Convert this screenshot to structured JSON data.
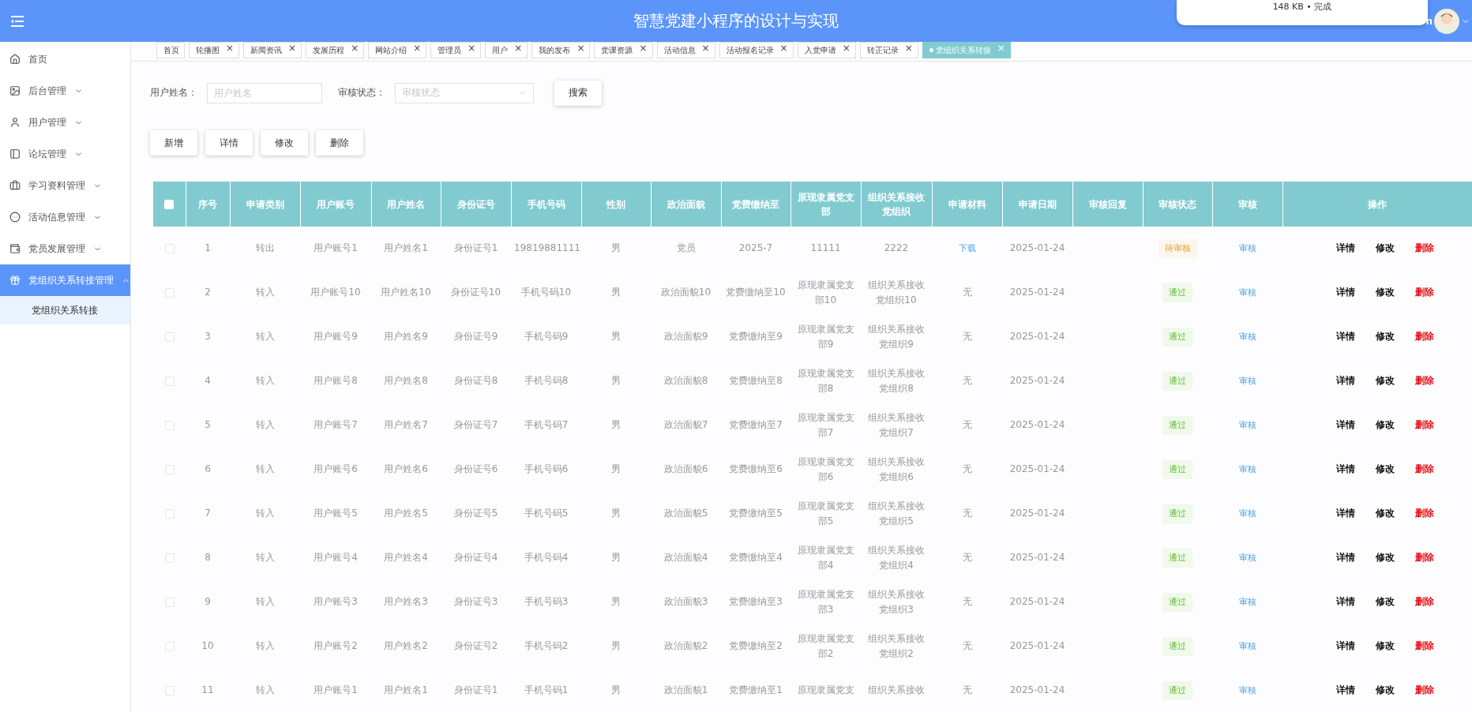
{
  "header": {
    "title": "智慧党建小程序的设计与实现",
    "user_fragment": "n"
  },
  "download_popup": {
    "text": "148 KB • 完成"
  },
  "sidebar": {
    "items": [
      {
        "label": "首页",
        "selected": false
      },
      {
        "label": "后台管理",
        "selected": false,
        "expanded": false
      },
      {
        "label": "用户管理",
        "selected": false,
        "expanded": false
      },
      {
        "label": "论坛管理",
        "selected": false,
        "expanded": false
      },
      {
        "label": "学习资料管理",
        "selected": false,
        "expanded": false
      },
      {
        "label": "活动信息管理",
        "selected": false,
        "expanded": false
      },
      {
        "label": "党员发展管理",
        "selected": false,
        "expanded": false
      },
      {
        "label": "党组织关系转接管理",
        "selected": true,
        "expanded": true,
        "children": [
          {
            "label": "党组织关系转接",
            "selected": true
          }
        ]
      }
    ]
  },
  "tabs": [
    {
      "label": "首页",
      "selected": false,
      "closable": false
    },
    {
      "label": "轮播图",
      "selected": false,
      "closable": true
    },
    {
      "label": "新闻资讯",
      "selected": false,
      "closable": true
    },
    {
      "label": "发展历程",
      "selected": false,
      "closable": true
    },
    {
      "label": "网站介绍",
      "selected": false,
      "closable": true
    },
    {
      "label": "管理员",
      "selected": false,
      "closable": true
    },
    {
      "label": "用户",
      "selected": false,
      "closable": true
    },
    {
      "label": "我的发布",
      "selected": false,
      "closable": true
    },
    {
      "label": "党课资源",
      "selected": false,
      "closable": true
    },
    {
      "label": "活动信息",
      "selected": false,
      "closable": true
    },
    {
      "label": "活动报名记录",
      "selected": false,
      "closable": true
    },
    {
      "label": "入党申请",
      "selected": false,
      "closable": true
    },
    {
      "label": "转正记录",
      "selected": false,
      "closable": true
    },
    {
      "label": "党组织关系转接",
      "selected": true,
      "closable": true
    }
  ],
  "tab_close_glyph": "×",
  "filters": [
    {
      "label": "用户姓名：",
      "kind": "input",
      "placeholder": "用户姓名"
    },
    {
      "label": "审核状态：",
      "kind": "select",
      "placeholder": "审核状态"
    }
  ],
  "search_button": "搜索",
  "actions": [
    "新增",
    "详情",
    "修改",
    "删除"
  ],
  "table": {
    "select_all_checked": false,
    "columns": [
      "序号",
      "申请类别",
      "用户账号",
      "用户姓名",
      "身份证号",
      "手机号码",
      "性别",
      "政治面貌",
      "党费缴纳至",
      "原现隶属党支部",
      "组织关系接收党组织",
      "申请材料",
      "申请日期",
      "审核回复",
      "审核状态",
      "审核",
      "操作"
    ],
    "rows": [
      {
        "checked": false,
        "cells": [
          "1",
          "转出",
          "用户账号1",
          "用户姓名1",
          "身份证号1",
          "19819881111",
          "男",
          "党员",
          "2025-7",
          "11111",
          "2222"
        ],
        "material": {
          "kind": "link",
          "text": "下载"
        },
        "date": "2025-01-24",
        "reply": "",
        "status": {
          "kind": "pending",
          "text": "待审核"
        },
        "review": "审核",
        "ops": [
          "详情",
          "修改",
          "删除"
        ]
      },
      {
        "checked": false,
        "cells": [
          "2",
          "转入",
          "用户账号10",
          "用户姓名10",
          "身份证号10",
          "手机号码10",
          "男",
          "政治面貌10",
          "党费缴纳至10",
          "原现隶属党支部10",
          "组织关系接收党组织10"
        ],
        "material": {
          "kind": "text",
          "text": "无"
        },
        "date": "2025-01-24",
        "reply": "",
        "status": {
          "kind": "approved",
          "text": "通过"
        },
        "review": "审核",
        "ops": [
          "详情",
          "修改",
          "删除"
        ]
      },
      {
        "checked": false,
        "cells": [
          "3",
          "转入",
          "用户账号9",
          "用户姓名9",
          "身份证号9",
          "手机号码9",
          "男",
          "政治面貌9",
          "党费缴纳至9",
          "原现隶属党支部9",
          "组织关系接收党组织9"
        ],
        "material": {
          "kind": "text",
          "text": "无"
        },
        "date": "2025-01-24",
        "reply": "",
        "status": {
          "kind": "approved",
          "text": "通过"
        },
        "review": "审核",
        "ops": [
          "详情",
          "修改",
          "删除"
        ]
      },
      {
        "checked": false,
        "cells": [
          "4",
          "转入",
          "用户账号8",
          "用户姓名8",
          "身份证号8",
          "手机号码8",
          "男",
          "政治面貌8",
          "党费缴纳至8",
          "原现隶属党支部8",
          "组织关系接收党组织8"
        ],
        "material": {
          "kind": "text",
          "text": "无"
        },
        "date": "2025-01-24",
        "reply": "",
        "status": {
          "kind": "approved",
          "text": "通过"
        },
        "review": "审核",
        "ops": [
          "详情",
          "修改",
          "删除"
        ]
      },
      {
        "checked": false,
        "cells": [
          "5",
          "转入",
          "用户账号7",
          "用户姓名7",
          "身份证号7",
          "手机号码7",
          "男",
          "政治面貌7",
          "党费缴纳至7",
          "原现隶属党支部7",
          "组织关系接收党组织7"
        ],
        "material": {
          "kind": "text",
          "text": "无"
        },
        "date": "2025-01-24",
        "reply": "",
        "status": {
          "kind": "approved",
          "text": "通过"
        },
        "review": "审核",
        "ops": [
          "详情",
          "修改",
          "删除"
        ]
      },
      {
        "checked": false,
        "cells": [
          "6",
          "转入",
          "用户账号6",
          "用户姓名6",
          "身份证号6",
          "手机号码6",
          "男",
          "政治面貌6",
          "党费缴纳至6",
          "原现隶属党支部6",
          "组织关系接收党组织6"
        ],
        "material": {
          "kind": "text",
          "text": "无"
        },
        "date": "2025-01-24",
        "reply": "",
        "status": {
          "kind": "approved",
          "text": "通过"
        },
        "review": "审核",
        "ops": [
          "详情",
          "修改",
          "删除"
        ]
      },
      {
        "checked": false,
        "cells": [
          "7",
          "转入",
          "用户账号5",
          "用户姓名5",
          "身份证号5",
          "手机号码5",
          "男",
          "政治面貌5",
          "党费缴纳至5",
          "原现隶属党支部5",
          "组织关系接收党组织5"
        ],
        "material": {
          "kind": "text",
          "text": "无"
        },
        "date": "2025-01-24",
        "reply": "",
        "status": {
          "kind": "approved",
          "text": "通过"
        },
        "review": "审核",
        "ops": [
          "详情",
          "修改",
          "删除"
        ]
      },
      {
        "checked": false,
        "cells": [
          "8",
          "转入",
          "用户账号4",
          "用户姓名4",
          "身份证号4",
          "手机号码4",
          "男",
          "政治面貌4",
          "党费缴纳至4",
          "原现隶属党支部4",
          "组织关系接收党组织4"
        ],
        "material": {
          "kind": "text",
          "text": "无"
        },
        "date": "2025-01-24",
        "reply": "",
        "status": {
          "kind": "approved",
          "text": "通过"
        },
        "review": "审核",
        "ops": [
          "详情",
          "修改",
          "删除"
        ]
      },
      {
        "checked": false,
        "cells": [
          "9",
          "转入",
          "用户账号3",
          "用户姓名3",
          "身份证号3",
          "手机号码3",
          "男",
          "政治面貌3",
          "党费缴纳至3",
          "原现隶属党支部3",
          "组织关系接收党组织3"
        ],
        "material": {
          "kind": "text",
          "text": "无"
        },
        "date": "2025-01-24",
        "reply": "",
        "status": {
          "kind": "approved",
          "text": "通过"
        },
        "review": "审核",
        "ops": [
          "详情",
          "修改",
          "删除"
        ]
      },
      {
        "checked": false,
        "cells": [
          "10",
          "转入",
          "用户账号2",
          "用户姓名2",
          "身份证号2",
          "手机号码2",
          "男",
          "政治面貌2",
          "党费缴纳至2",
          "原现隶属党支部2",
          "组织关系接收党组织2"
        ],
        "material": {
          "kind": "text",
          "text": "无"
        },
        "date": "2025-01-24",
        "reply": "",
        "status": {
          "kind": "approved",
          "text": "通过"
        },
        "review": "审核",
        "ops": [
          "详情",
          "修改",
          "删除"
        ]
      },
      {
        "checked": false,
        "cells": [
          "11",
          "转入",
          "用户账号1",
          "用户姓名1",
          "身份证号1",
          "手机号码1",
          "男",
          "政治面貌1",
          "党费缴纳至1",
          "原现隶属党支",
          "组织关系接收"
        ],
        "material": {
          "kind": "text",
          "text": "无"
        },
        "date": "2025-01-24",
        "reply": "",
        "status": {
          "kind": "approved",
          "text": "通过"
        },
        "review": "审核",
        "ops": [
          "详情",
          "修改",
          "删除"
        ]
      }
    ]
  }
}
